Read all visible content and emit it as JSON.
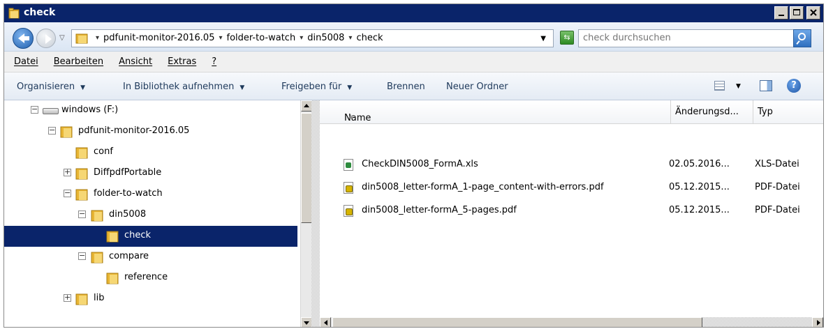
{
  "window": {
    "title": "check",
    "controls": {
      "minimize": "_",
      "maximize": "□",
      "close": "×"
    }
  },
  "address_bar": {
    "breadcrumbs": [
      "pdfunit-monitor-2016.05",
      "folder-to-watch",
      "din5008",
      "check"
    ],
    "search_placeholder": "check durchsuchen"
  },
  "menu": {
    "items": [
      "Datei",
      "Bearbeiten",
      "Ansicht",
      "Extras",
      "?"
    ]
  },
  "toolbar": {
    "organize": "Organisieren",
    "include_library": "In Bibliothek aufnehmen",
    "share": "Freigeben für",
    "burn": "Brennen",
    "new_folder": "Neuer Ordner",
    "help": "?"
  },
  "tree": {
    "items": [
      {
        "label": "windows (F:)",
        "type": "drive",
        "expander": "−"
      },
      {
        "label": "pdfunit-monitor-2016.05",
        "type": "folder",
        "expander": "−"
      },
      {
        "label": "conf",
        "type": "folder",
        "expander": ""
      },
      {
        "label": "DiffpdfPortable",
        "type": "folder",
        "expander": "+"
      },
      {
        "label": "folder-to-watch",
        "type": "folder",
        "expander": "−"
      },
      {
        "label": "din5008",
        "type": "folder",
        "expander": "−"
      },
      {
        "label": "check",
        "type": "folder",
        "expander": "",
        "selected": true
      },
      {
        "label": "compare",
        "type": "folder",
        "expander": "−"
      },
      {
        "label": "reference",
        "type": "folder",
        "expander": ""
      },
      {
        "label": "lib",
        "type": "folder",
        "expander": "+"
      }
    ]
  },
  "files": {
    "columns": {
      "name": "Name",
      "date": "Änderungsd...",
      "type": "Typ"
    },
    "rows": [
      {
        "name": "CheckDIN5008_FormA.xls",
        "date": "02.05.2016...",
        "type": "XLS-Datei",
        "icon": "xls-file-icon"
      },
      {
        "name": "din5008_letter-formA_1-page_content-with-errors.pdf",
        "date": "05.12.2015...",
        "type": "PDF-Datei",
        "icon": "pdf-file-icon"
      },
      {
        "name": "din5008_letter-formA_5-pages.pdf",
        "date": "05.12.2015...",
        "type": "PDF-Datei",
        "icon": "pdf-file-icon"
      }
    ]
  },
  "colors": {
    "title_bar": "#0a246a",
    "selection": "#0a246a",
    "folder": "#f0c94a"
  }
}
